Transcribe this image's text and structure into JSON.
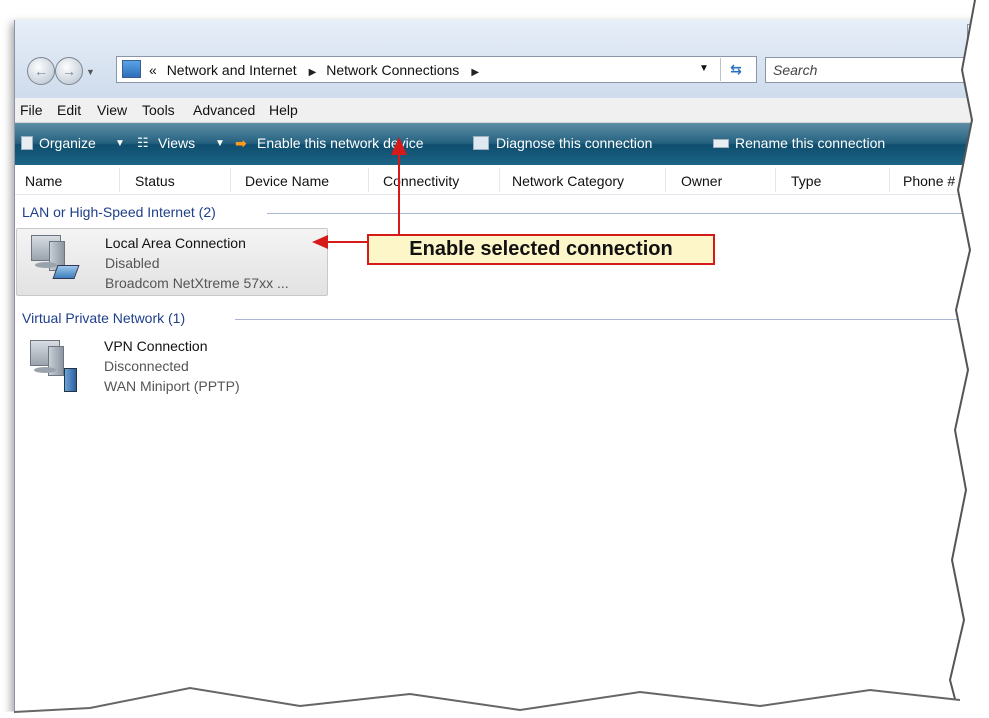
{
  "address_bar": {
    "prefix": "«",
    "crumbs": [
      "Network and Internet",
      "Network Connections"
    ],
    "search_placeholder": "Search"
  },
  "menu": [
    "File",
    "Edit",
    "View",
    "Tools",
    "Advanced",
    "Help"
  ],
  "command_bar": {
    "organize": "Organize",
    "views": "Views",
    "enable": "Enable this network device",
    "diagnose": "Diagnose this connection",
    "rename": "Rename this connection"
  },
  "columns": [
    "Name",
    "Status",
    "Device Name",
    "Connectivity",
    "Network Category",
    "Owner",
    "Type",
    "Phone # o"
  ],
  "groups": [
    {
      "title": "LAN or High-Speed Internet (2)",
      "items": [
        {
          "name": "Local Area Connection",
          "status": "Disabled",
          "device": "Broadcom NetXtreme 57xx ..."
        }
      ]
    },
    {
      "title": "Virtual Private Network (1)",
      "items": [
        {
          "name": "VPN Connection",
          "status": "Disconnected",
          "device": "WAN Miniport (PPTP)"
        }
      ]
    }
  ],
  "callout": "Enable selected connection",
  "colors": {
    "callout_border": "#d61a1a",
    "callout_fill": "#fdf6c8",
    "command_bar": "#1c6485"
  }
}
